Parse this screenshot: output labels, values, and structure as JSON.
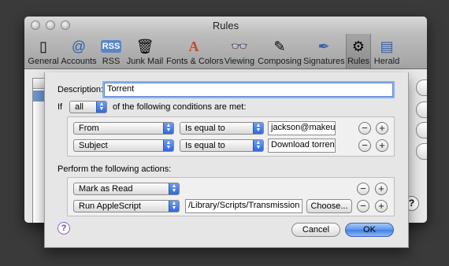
{
  "window": {
    "title": "Rules"
  },
  "toolbar": {
    "items": [
      {
        "label": "General",
        "icon": "general-icon",
        "glyph": "▯",
        "selected": false
      },
      {
        "label": "Accounts",
        "icon": "at-sign-icon",
        "glyph": "@",
        "selected": false
      },
      {
        "label": "RSS",
        "icon": "rss-icon",
        "glyph": "RSS",
        "selected": false
      },
      {
        "label": "Junk Mail",
        "icon": "trash-icon",
        "glyph": "🗑",
        "selected": false
      },
      {
        "label": "Fonts & Colors",
        "icon": "font-icon",
        "glyph": "A",
        "selected": false
      },
      {
        "label": "Viewing",
        "icon": "viewing-icon",
        "glyph": "👓",
        "selected": false
      },
      {
        "label": "Composing",
        "icon": "compose-icon",
        "glyph": "✎",
        "selected": false
      },
      {
        "label": "Signatures",
        "icon": "signature-icon",
        "glyph": "✒",
        "selected": false
      },
      {
        "label": "Rules",
        "icon": "rules-icon",
        "glyph": "⚙",
        "selected": true
      },
      {
        "label": "Herald",
        "icon": "herald-icon",
        "glyph": "▤",
        "selected": false
      }
    ]
  },
  "background": {
    "help_label": "?"
  },
  "sheet": {
    "description_label": "Description:",
    "description_value": "Torrent",
    "if_label": "If",
    "match_value": "all",
    "match_suffix": "of the following conditions are met:",
    "conditions": [
      {
        "field": "From",
        "operator": "Is equal to",
        "value": "jackson@makeuse"
      },
      {
        "field": "Subject",
        "operator": "Is equal to",
        "value": "Download torrent"
      }
    ],
    "actions_label": "Perform the following actions:",
    "actions": [
      {
        "action": "Mark as Read",
        "value": "",
        "has_choose": false
      },
      {
        "action": "Run AppleScript",
        "value": "/Library/Scripts/Transmission vi",
        "has_choose": true
      }
    ],
    "choose_label": "Choose...",
    "remove_label": "−",
    "add_label": "+",
    "cancel_label": "Cancel",
    "ok_label": "OK",
    "help_label": "?"
  },
  "colors": {
    "default_button": "#3f7fe3",
    "popup_arrow": "#2f69d9",
    "focus_ring": "#8db2e8"
  }
}
